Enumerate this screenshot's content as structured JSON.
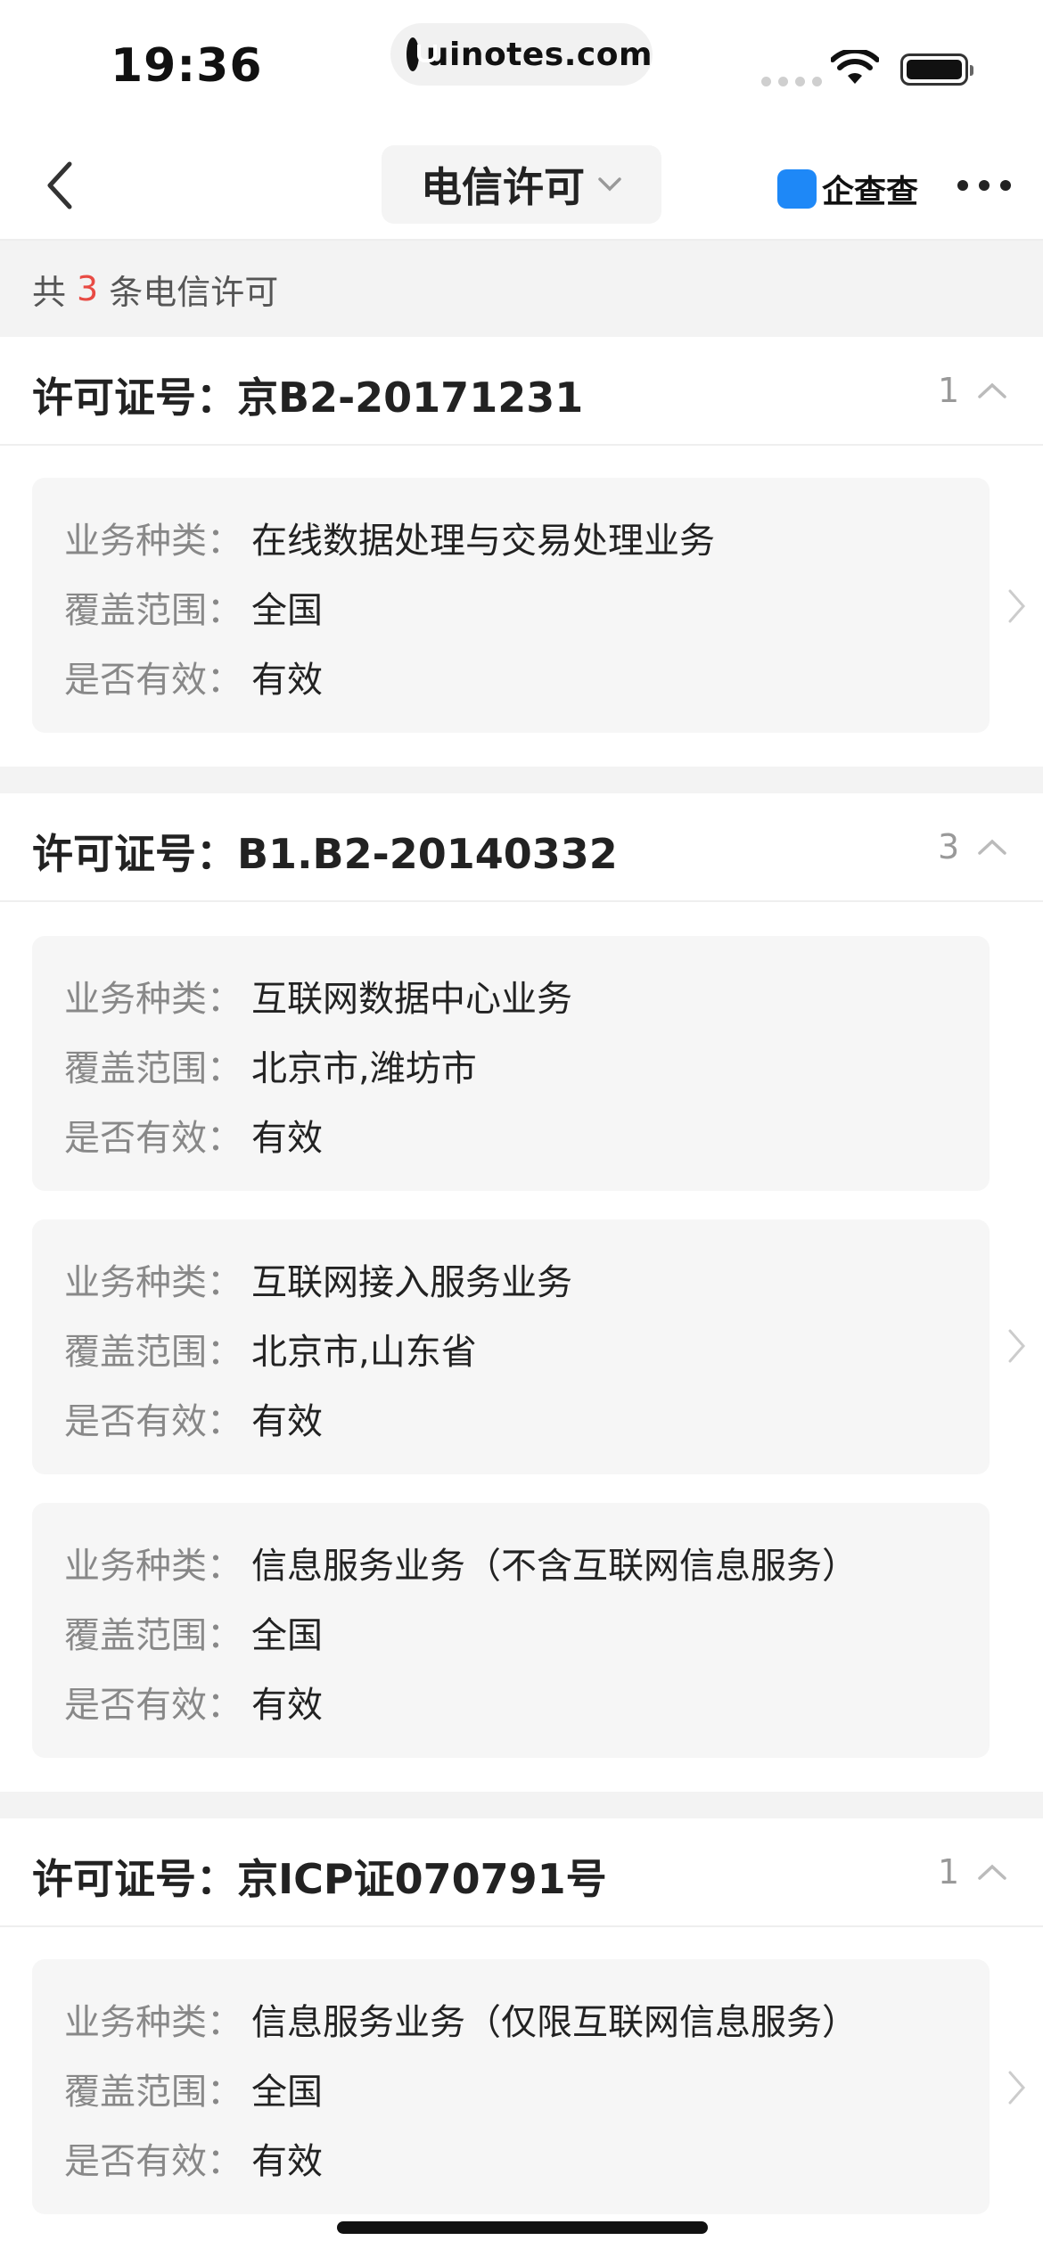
{
  "status_bar": {
    "time": "19:36",
    "url": "uinotes.com"
  },
  "nav": {
    "title": "电信许可",
    "brand": "企查查"
  },
  "summary": {
    "prefix": "共",
    "count": "3",
    "suffix": "条电信许可"
  },
  "labels": {
    "type": "业务种类：",
    "scope": "覆盖范围：",
    "valid": "是否有效："
  },
  "sections": [
    {
      "title": "许可证号：京B2-20171231",
      "count": "1",
      "items": [
        {
          "type": "在线数据处理与交易处理业务",
          "scope": "全国",
          "valid": "有效"
        }
      ]
    },
    {
      "title": "许可证号：B1.B2-20140332",
      "count": "3",
      "items": [
        {
          "type": "互联网数据中心业务",
          "scope": "北京市,潍坊市",
          "valid": "有效"
        },
        {
          "type": "互联网接入服务业务",
          "scope": "北京市,山东省",
          "valid": "有效"
        },
        {
          "type": "信息服务业务（不含互联网信息服务）",
          "scope": "全国",
          "valid": "有效"
        }
      ]
    },
    {
      "title": "许可证号：京ICP证070791号",
      "count": "1",
      "items": [
        {
          "type": "信息服务业务（仅限互联网信息服务）",
          "scope": "全国",
          "valid": "有效"
        }
      ]
    }
  ],
  "colors": {
    "accent_count": "#e84b44",
    "brand_blue": "#1e88f7"
  }
}
